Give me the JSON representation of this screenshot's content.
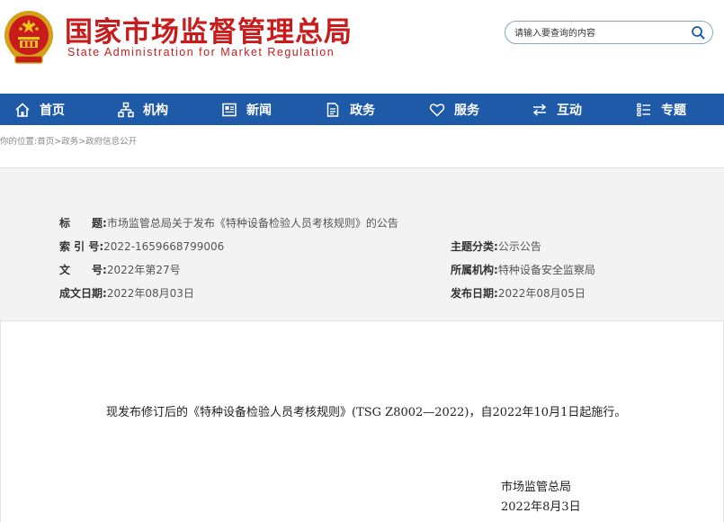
{
  "header": {
    "title": "国家市场监督管理总局",
    "subtitle": "State Administration for Market Regulation",
    "emblem_icon": "national-emblem-icon",
    "search": {
      "placeholder": "请输入要查询的内容",
      "icon": "search-icon"
    }
  },
  "nav": {
    "items": [
      {
        "label": "首页",
        "icon": "home-icon"
      },
      {
        "label": "机构",
        "icon": "org-chart-icon"
      },
      {
        "label": "新闻",
        "icon": "news-icon"
      },
      {
        "label": "政务",
        "icon": "document-icon"
      },
      {
        "label": "服务",
        "icon": "heart-icon"
      },
      {
        "label": "互动",
        "icon": "exchange-icon"
      },
      {
        "label": "专题",
        "icon": "list-icon"
      }
    ]
  },
  "breadcrumb": {
    "prefix": "你的位置:",
    "items": [
      "首页",
      "政务",
      "政府信息公开"
    ],
    "separator": ">"
  },
  "meta": {
    "title_label": "标　　题:",
    "title_value": "市场监管总局关于发布《特种设备检验人员考核规则》的公告",
    "index_label": "索 引 号:",
    "index_value": "2022-1659668799006",
    "doc_no_label": "文　　号:",
    "doc_no_value": "2022年第27号",
    "created_label": "成文日期:",
    "created_value": "2022年08月03日",
    "topic_label": "主题分类:",
    "topic_value": "公示公告",
    "agency_label": "所属机构:",
    "agency_value": "特种设备安全监察局",
    "published_label": "发布日期:",
    "published_value": "2022年08月05日"
  },
  "content": {
    "body": "现发布修订后的《特种设备检验人员考核规则》(TSG Z8002—2022)，自2022年10月1日起施行。",
    "signature": "市场监管总局",
    "date": "2022年8月3日"
  },
  "colors": {
    "brand_red": "#c81c1c",
    "nav_blue": "#1e5aa8",
    "meta_bg": "#f3f3f3"
  }
}
